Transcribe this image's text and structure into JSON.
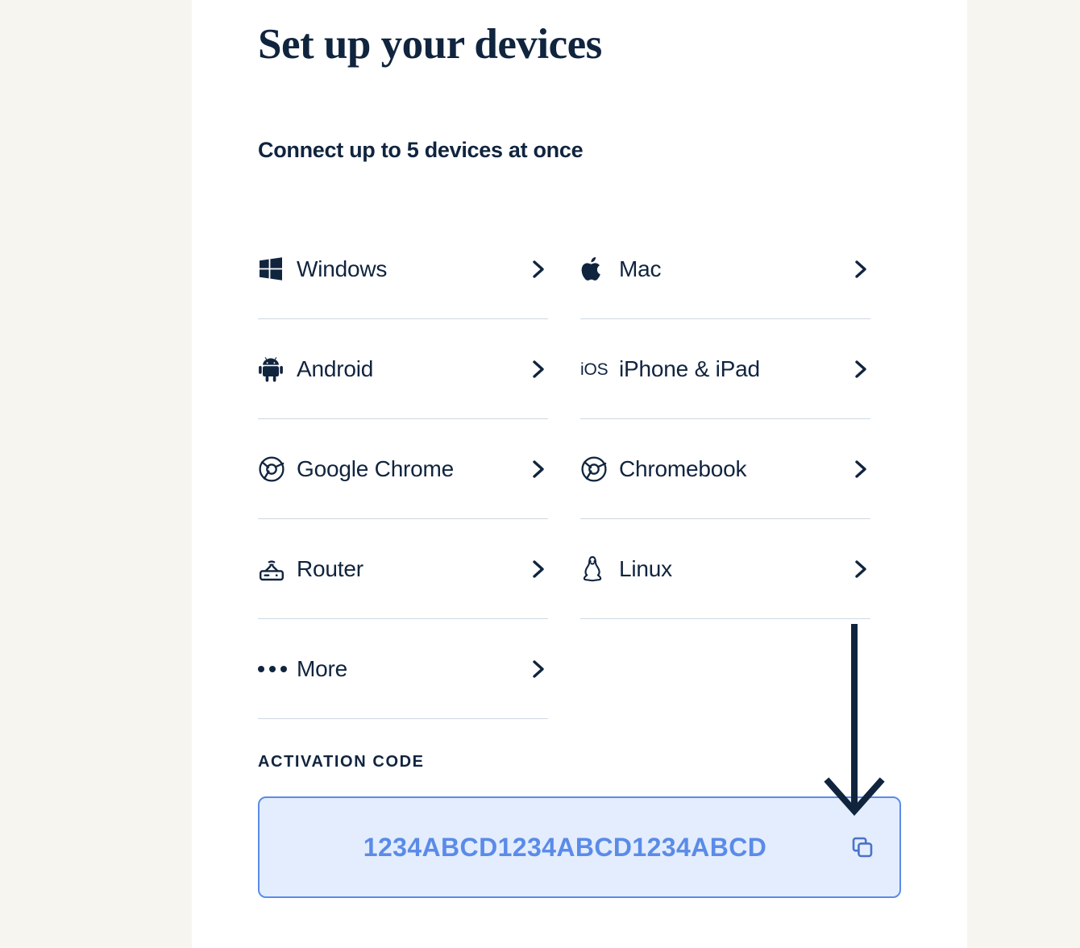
{
  "page": {
    "title": "Set up your devices",
    "subtitle": "Connect up to 5 devices at once"
  },
  "colors": {
    "background": "#f7f5f0",
    "card": "#ffffff",
    "text": "#10243e",
    "divider": "#cdd8e3",
    "code_text": "#5b8be8",
    "code_background": "#e3edfd",
    "code_border": "#5b8be8",
    "arrow": "#10243e"
  },
  "devices": {
    "left": [
      {
        "label": "Windows",
        "icon": "windows-icon",
        "chevron": "chevron-right-icon"
      },
      {
        "label": "Android",
        "icon": "android-icon",
        "chevron": "chevron-right-icon"
      },
      {
        "label": "Google Chrome",
        "icon": "chrome-icon",
        "chevron": "chevron-right-icon"
      },
      {
        "label": "Router",
        "icon": "router-icon",
        "chevron": "chevron-right-icon"
      },
      {
        "label": "More",
        "icon": "ellipsis-icon",
        "chevron": "chevron-right-icon"
      }
    ],
    "right": [
      {
        "label": "Mac",
        "icon": "apple-icon",
        "chevron": "chevron-right-icon"
      },
      {
        "label": "iPhone & iPad",
        "icon": "ios-icon",
        "icon_text": "iOS",
        "chevron": "chevron-right-icon"
      },
      {
        "label": "Chromebook",
        "icon": "chrome-icon",
        "chevron": "chevron-right-icon"
      },
      {
        "label": "Linux",
        "icon": "linux-icon",
        "chevron": "chevron-right-icon"
      }
    ]
  },
  "activation": {
    "label": "ACTIVATION CODE",
    "code": "1234ABCD1234ABCD1234ABCD",
    "copy_icon": "copy-icon"
  },
  "annotation": {
    "arrow_icon": "down-arrow-annotation"
  }
}
